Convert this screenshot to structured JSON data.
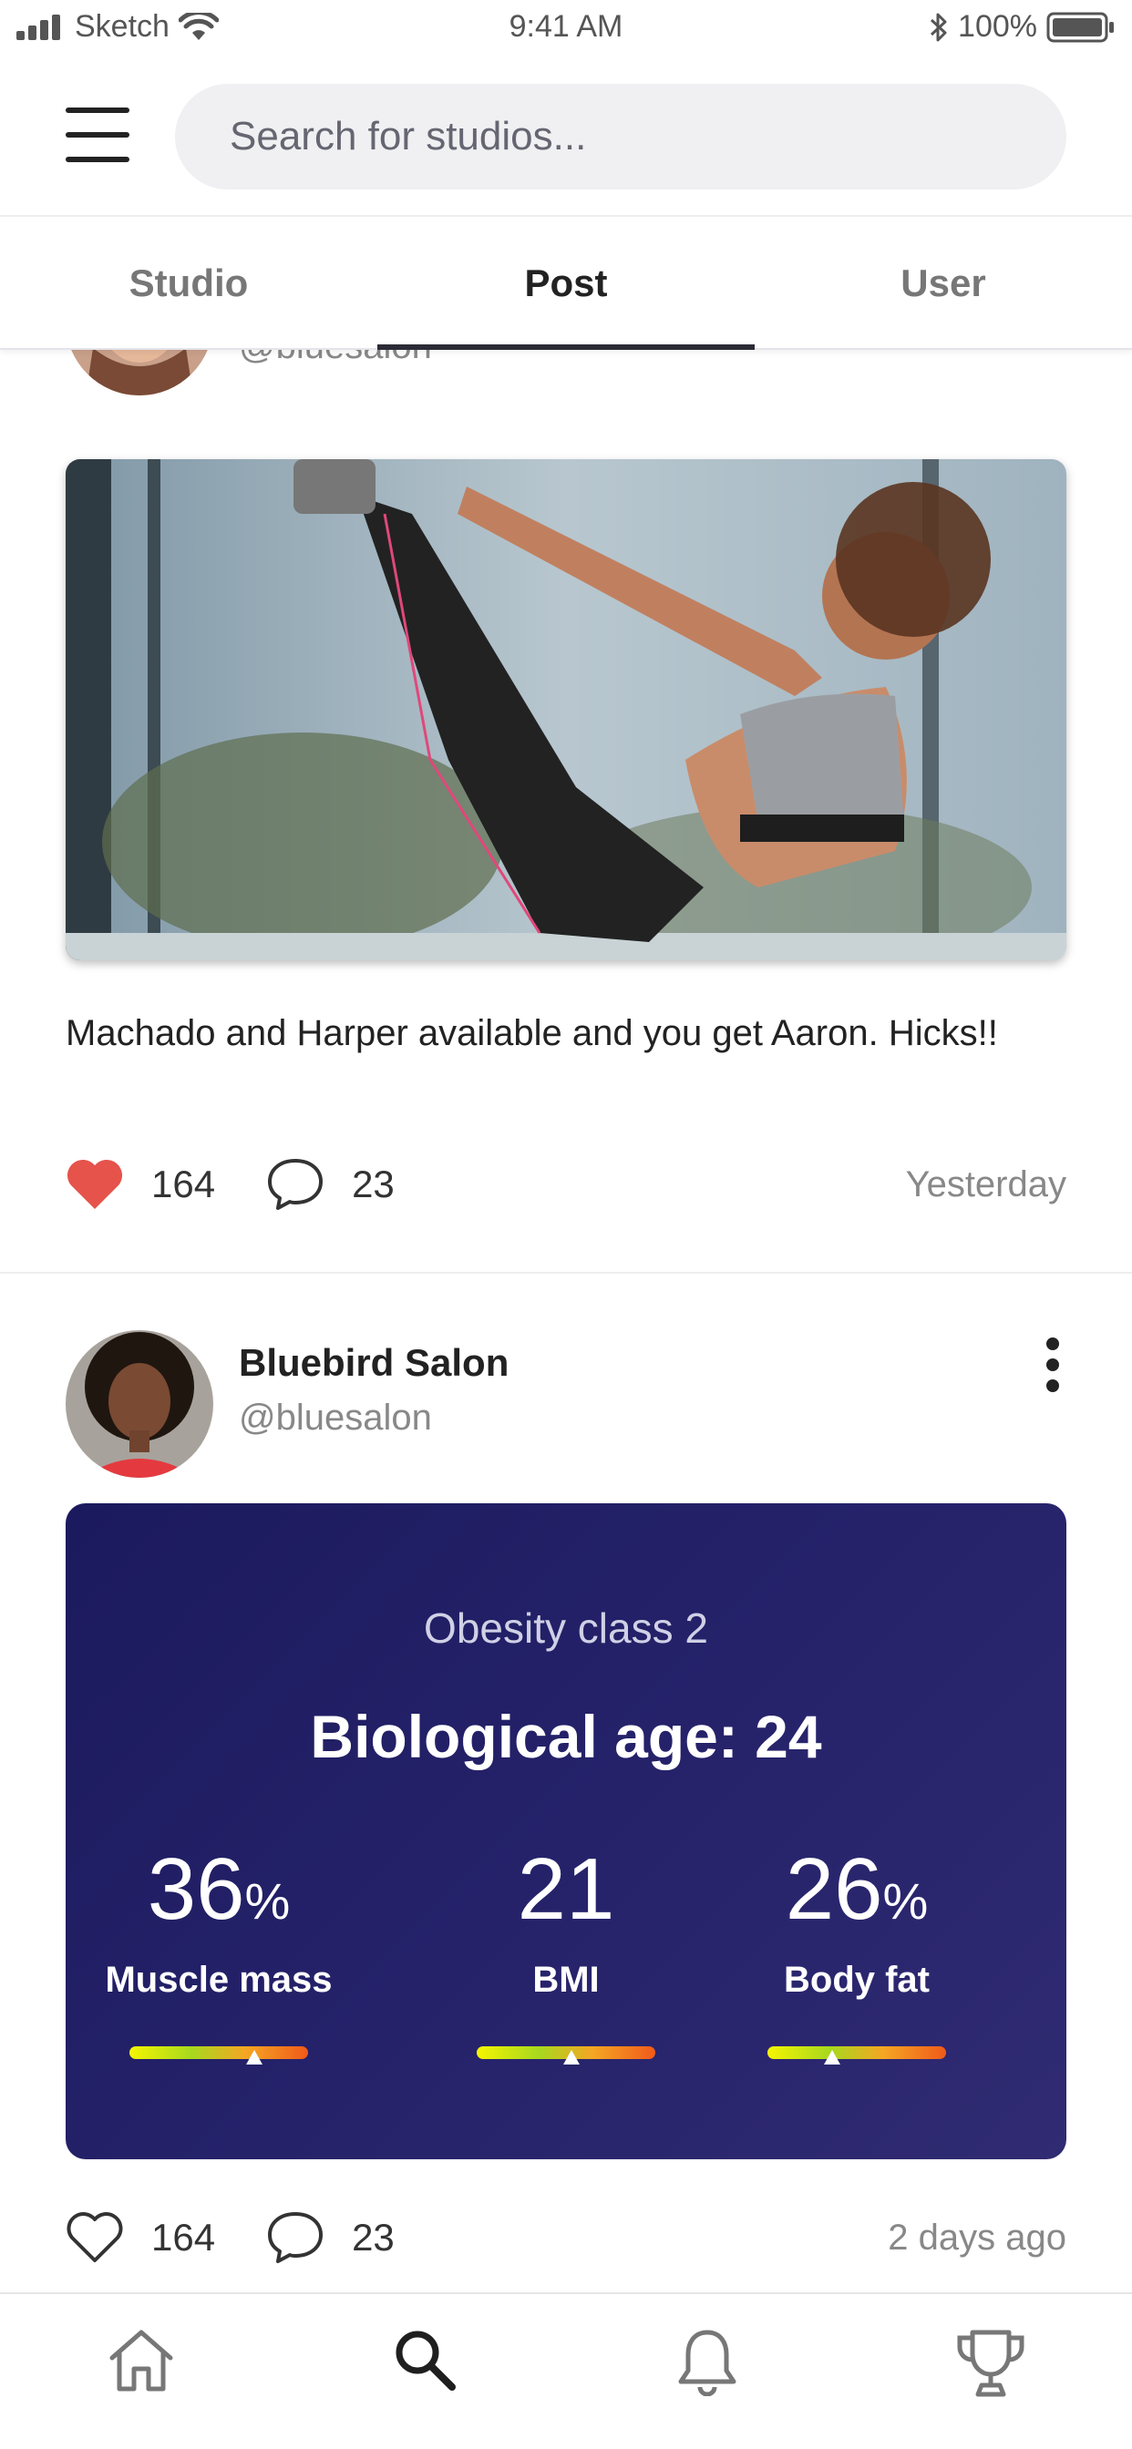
{
  "status_bar": {
    "carrier": "Sketch",
    "time": "9:41 AM",
    "battery": "100%"
  },
  "header": {
    "search_placeholder": "Search for studios..."
  },
  "tabs": [
    {
      "label": "Studio",
      "active": false
    },
    {
      "label": "Post",
      "active": true
    },
    {
      "label": "User",
      "active": false
    }
  ],
  "posts": [
    {
      "username": "@bluesalon",
      "caption": "Machado and Harper available and you get Aaron. Hicks!!",
      "likes": "164",
      "comments": "23",
      "time": "Yesterday",
      "liked": true
    },
    {
      "author": "Bluebird Salon",
      "username": "@bluesalon",
      "card": {
        "class_label": "Obesity class 2",
        "bio_age": "Biological age: 24",
        "metrics": [
          {
            "value": "36",
            "unit": "%",
            "label": "Muscle mass",
            "level": 0.7
          },
          {
            "value": "21",
            "unit": "",
            "label": "BMI",
            "level": 0.53
          },
          {
            "value": "26",
            "unit": "%",
            "label": "Body fat",
            "level": 0.36
          }
        ]
      },
      "likes": "164",
      "comments": "23",
      "time": "2 days ago",
      "liked": false
    }
  ],
  "colors": {
    "like_active": "#e5534b",
    "card_bg": "#231f66",
    "accent_dark": "#2b2b36"
  },
  "bottom_nav": [
    "home-icon",
    "search-icon",
    "bell-icon",
    "trophy-icon"
  ]
}
